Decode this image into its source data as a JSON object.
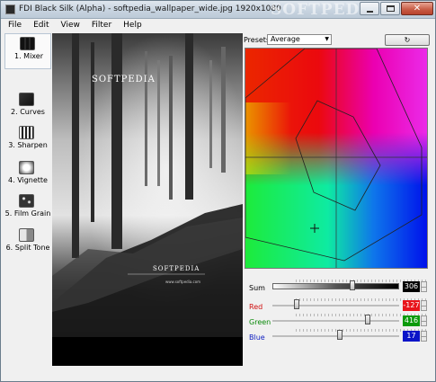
{
  "window": {
    "title": "FDI Black Silk (Alpha) - softpedia_wallpaper_wide.jpg 1920x1080",
    "watermark": "SOFTPEDIA"
  },
  "menu": [
    "File",
    "Edit",
    "View",
    "Filter",
    "Help"
  ],
  "tools": [
    {
      "label": "1. Mixer",
      "icon": "mixer-icon",
      "active": true
    },
    {
      "label": "2. Curves",
      "icon": "curves-icon",
      "active": false
    },
    {
      "label": "3. Sharpen",
      "icon": "sharpen-icon",
      "active": false
    },
    {
      "label": "4. Vignette",
      "icon": "vignette-icon",
      "active": false
    },
    {
      "label": "5. Film Grain",
      "icon": "film-grain-icon",
      "active": false
    },
    {
      "label": "6. Split Tone",
      "icon": "split-tone-icon",
      "active": false
    }
  ],
  "photo": {
    "brand_top": "SOFTPEDIA",
    "brand_bottom": "SOFTPEDIA",
    "url": "www.softpedia.com"
  },
  "presets": {
    "label": "Presets:",
    "value": "Average",
    "reset_icon": "reset-icon"
  },
  "sliders": [
    {
      "name": "sum",
      "label": "Sum",
      "value": "306",
      "box_color": "#000000",
      "label_color": "#000000",
      "level": 0.64
    },
    {
      "name": "red",
      "label": "Red",
      "value": "-127",
      "box_color": "#e8141a",
      "label_color": "#d01010",
      "level": 0.18
    },
    {
      "name": "green",
      "label": "Green",
      "value": "416",
      "box_color": "#0a9a0a",
      "label_color": "#0a8a0a",
      "level": 0.76
    },
    {
      "name": "blue",
      "label": "Blue",
      "value": "17",
      "box_color": "#0a14c8",
      "label_color": "#1020c0",
      "level": 0.53
    }
  ]
}
